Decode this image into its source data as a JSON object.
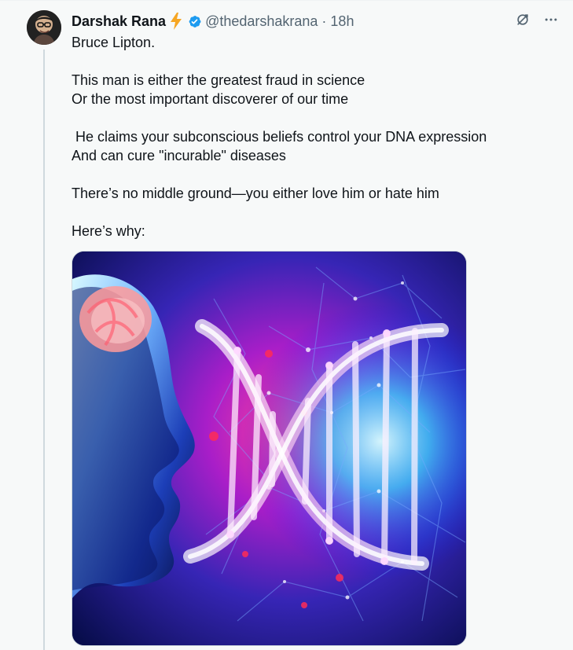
{
  "tweet": {
    "author": {
      "display_name": "Darshak Rana",
      "handle": "@thedarshakrana",
      "time": "18h",
      "separator": "·",
      "verified": true,
      "avatar_icon": "profile-photo"
    },
    "text": "Bruce Lipton.\n\nThis man is either the greatest fraud in science\nOr the most important discoverer of our time\n\n He claims your subconscious beliefs control your DNA expression\nAnd can cure \"incurable\" diseases\n\nThere’s no middle ground—you either love him or hate him\n\nHere’s why:",
    "icons": {
      "bolt": "lightning-icon",
      "verified": "verified-badge-icon",
      "grok": "grok-icon",
      "more": "more-icon"
    },
    "media": {
      "alt_icon": "dna-image"
    },
    "colors": {
      "background": "#f7f9f9",
      "verified": "#1d9bf0",
      "text": "#0f1419",
      "muted": "#536471"
    }
  }
}
